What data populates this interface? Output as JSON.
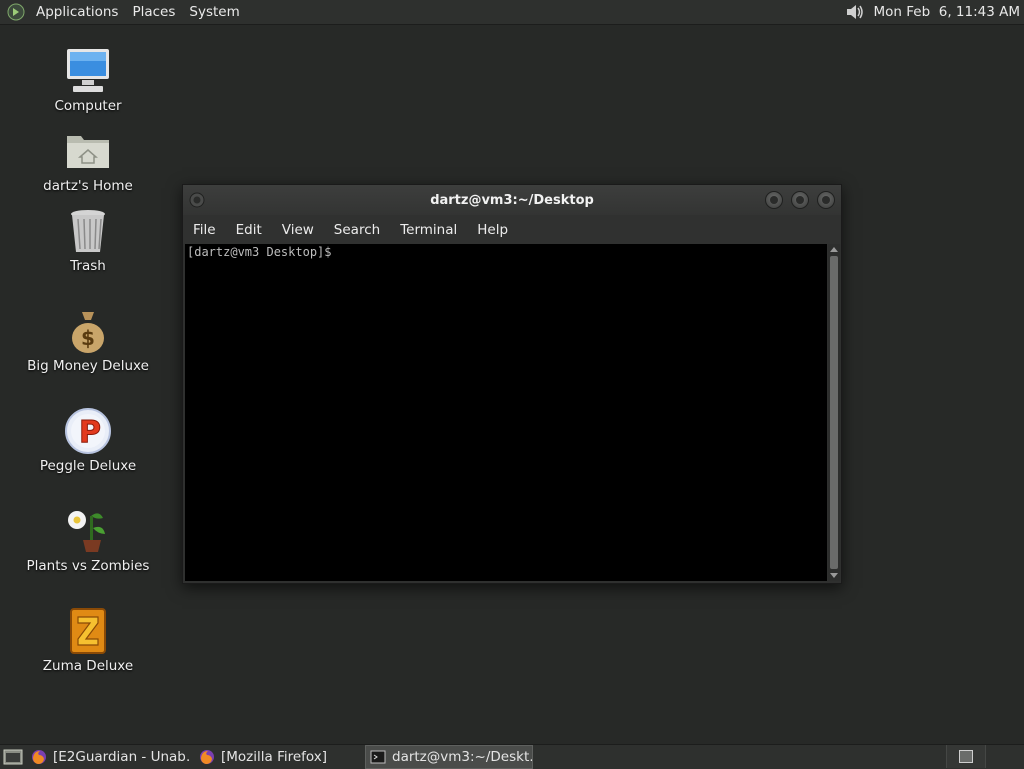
{
  "top_panel": {
    "menus": [
      "Applications",
      "Places",
      "System"
    ],
    "clock": "Mon Feb  6, 11:43 AM",
    "icons": [
      "gnome-foot-logo",
      "volume-icon"
    ]
  },
  "desktop_icons": [
    {
      "label": "Computer",
      "icon": "computer-icon"
    },
    {
      "label": "dartz's Home",
      "icon": "home-folder-icon"
    },
    {
      "label": "Trash",
      "icon": "trash-icon"
    },
    {
      "label": "Big Money Deluxe",
      "icon": "money-bag-icon"
    },
    {
      "label": "Peggle Deluxe",
      "icon": "peggle-icon"
    },
    {
      "label": "Plants vs Zombies",
      "icon": "plants-icon"
    },
    {
      "label": "Zuma Deluxe",
      "icon": "zuma-icon"
    }
  ],
  "terminal": {
    "title": "dartz@vm3:~/Desktop",
    "menus": [
      "File",
      "Edit",
      "View",
      "Search",
      "Terminal",
      "Help"
    ],
    "prompt": "[dartz@vm3 Desktop]$"
  },
  "taskbar": {
    "tasks": [
      {
        "label": "[E2Guardian - Unab…",
        "icon": "firefox-icon"
      },
      {
        "label": "[Mozilla Firefox]",
        "icon": "firefox-icon"
      },
      {
        "label": "dartz@vm3:~/Deskt…",
        "icon": "terminal-icon"
      }
    ]
  },
  "colors": {
    "desktop_bg": "#272927",
    "panel_bg": "#2e302e",
    "terminal_bg": "#000000"
  }
}
